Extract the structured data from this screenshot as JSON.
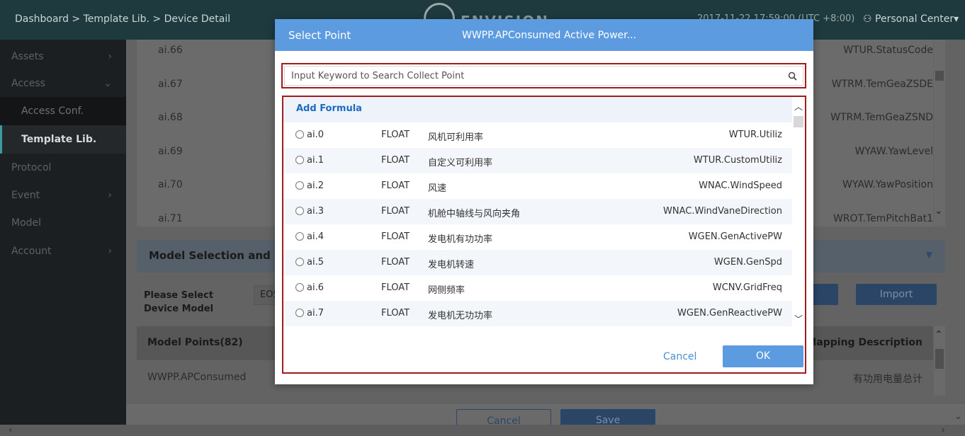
{
  "topbar": {
    "breadcrumb": "Dashboard > Template Lib. > Device Detail",
    "brand": "ENVISION",
    "time": "2017-11-22 17:59:00 (UTC +8:00)",
    "user_label": "Personal Center"
  },
  "sidebar": {
    "items": [
      {
        "label": "Assets",
        "chevron": "›"
      },
      {
        "label": "Access",
        "chevron": "⌄"
      },
      {
        "label": "Access Conf."
      },
      {
        "label": "Template Lib."
      },
      {
        "label": "Protocol"
      },
      {
        "label": "Event",
        "chevron": "›"
      },
      {
        "label": "Model"
      },
      {
        "label": "Account",
        "chevron": "›"
      }
    ]
  },
  "background": {
    "rows": [
      {
        "code": "ai.66",
        "name": "WTUR.StatusCode"
      },
      {
        "code": "ai.67",
        "name": "WTRM.TemGeaZSDE"
      },
      {
        "code": "ai.68",
        "name": "WTRM.TemGeaZSND"
      },
      {
        "code": "ai.69",
        "name": "WYAW.YawLevel"
      },
      {
        "code": "ai.70",
        "name": "WYAW.YawPosition"
      },
      {
        "code": "ai.71",
        "name": "WROT.TemPitchBat1"
      }
    ],
    "section_title": "Model Selection and Ma",
    "select_label_1": "Please Select",
    "select_label_2": "Device Model",
    "select_value": "EOS",
    "import_button": "Import",
    "model_points_header": "Model Points(82)",
    "mapping_header": "Mapping Description",
    "model_row_name": "WWPP.APConsumed",
    "model_row_desc": "有功用电量总计",
    "cancel_button": "Cancel",
    "save_button": "Save"
  },
  "modal": {
    "title": "Select Point",
    "subtitle": "WWPP.APConsumed Active Power...",
    "search_placeholder": "Input Keyword to Search Collect Point",
    "add_formula": "Add Formula",
    "points": [
      {
        "code": "ai.0",
        "type": "FLOAT",
        "desc": "风机可利用率",
        "name": "WTUR.Utiliz"
      },
      {
        "code": "ai.1",
        "type": "FLOAT",
        "desc": "自定义可利用率",
        "name": "WTUR.CustomUtiliz"
      },
      {
        "code": "ai.2",
        "type": "FLOAT",
        "desc": "风速",
        "name": "WNAC.WindSpeed"
      },
      {
        "code": "ai.3",
        "type": "FLOAT",
        "desc": "机舱中轴线与风向夹角",
        "name": "WNAC.WindVaneDirection"
      },
      {
        "code": "ai.4",
        "type": "FLOAT",
        "desc": "发电机有功功率",
        "name": "WGEN.GenActivePW"
      },
      {
        "code": "ai.5",
        "type": "FLOAT",
        "desc": "发电机转速",
        "name": "WGEN.GenSpd"
      },
      {
        "code": "ai.6",
        "type": "FLOAT",
        "desc": "网侧频率",
        "name": "WCNV.GridFreq"
      },
      {
        "code": "ai.7",
        "type": "FLOAT",
        "desc": "发电机无功功率",
        "name": "WGEN.GenReactivePW"
      }
    ],
    "cancel_label": "Cancel",
    "ok_label": "OK"
  },
  "colors": {
    "modal_header": "#5d9be0",
    "highlight_border": "#a11b1b",
    "link_blue": "#1d6bbf"
  }
}
